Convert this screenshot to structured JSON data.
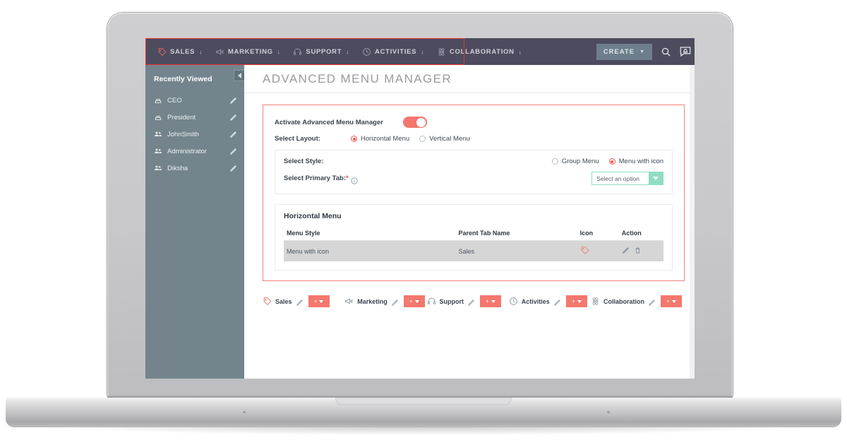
{
  "topnav": {
    "items": [
      {
        "label": "SALES",
        "icon": "tag-icon",
        "caret": "↓"
      },
      {
        "label": "MARKETING",
        "icon": "megaphone-icon",
        "caret": "↓"
      },
      {
        "label": "SUPPORT",
        "icon": "headset-icon",
        "caret": "↓"
      },
      {
        "label": "ACTIVITIES",
        "icon": "clock-icon",
        "caret": "↓"
      },
      {
        "label": "COLLABORATION",
        "icon": "atom-icon",
        "caret": "↓"
      }
    ],
    "create_label": "CREATE",
    "create_caret": "▼",
    "search_icon": "search-icon",
    "notification_icon": "notification-bell-icon",
    "highlight_color": "#ec2f2f",
    "bar_color": "#4d4c5e"
  },
  "sidebar": {
    "title": "Recently Viewed",
    "collapse_icon": "collapse-left-icon",
    "bg_color": "#73848d",
    "items": [
      {
        "label": "CEO",
        "icon": "org-icon",
        "edit_icon": "pencil-icon"
      },
      {
        "label": "President",
        "icon": "org-icon",
        "edit_icon": "pencil-icon"
      },
      {
        "label": "JohnSmith",
        "icon": "users-icon",
        "edit_icon": "pencil-icon"
      },
      {
        "label": "Administrator",
        "icon": "users-icon",
        "edit_icon": "pencil-icon"
      },
      {
        "label": "Diksha",
        "icon": "users-icon",
        "edit_icon": "pencil-icon"
      }
    ]
  },
  "page": {
    "title": "ADVANCED MENU MANAGER",
    "panel_border_color": "#f0807c"
  },
  "form": {
    "activate_label": "Activate Advanced Menu Manager",
    "activate_toggle": {
      "state": "on",
      "color": "#f4776e"
    },
    "layout_label": "Select Layout:",
    "layout_options": [
      {
        "label": "Horizontal Menu",
        "selected": true
      },
      {
        "label": "Vertical Menu",
        "selected": false
      }
    ],
    "style_label": "Select Style:",
    "style_options": [
      {
        "label": "Group Menu",
        "selected": false
      },
      {
        "label": "Menu with icon",
        "selected": true
      }
    ],
    "primary_tab_label": "Select Primary Tab:",
    "primary_tab_required": "*",
    "primary_tab_info_icon": "info-icon",
    "primary_tab_select": {
      "value": "Select an option",
      "placeholder": "Select an option",
      "border_color": "#8fddc4"
    }
  },
  "table": {
    "title": "Horizontal Menu",
    "columns": [
      "Menu Style",
      "Parent Tab Name",
      "Icon",
      "Action"
    ],
    "rows": [
      {
        "menu_style": "Menu with icon",
        "parent_tab_name": "Sales",
        "icon": "tag-icon",
        "actions": [
          "pencil-icon",
          "trash-icon"
        ]
      }
    ]
  },
  "preview": {
    "items": [
      {
        "label": "Sales",
        "icon": "tag-icon",
        "edit_icon": "pencil-icon",
        "button": {
          "plus": "+",
          "caret": "▼"
        }
      },
      {
        "label": "Marketing",
        "icon": "megaphone-icon",
        "edit_icon": "pencil-icon",
        "button": {
          "plus": "+",
          "caret": "▼"
        }
      },
      {
        "label": "Support",
        "icon": "headset-icon",
        "edit_icon": "pencil-icon",
        "button": {
          "plus": "+",
          "caret": "▼"
        }
      },
      {
        "label": "Activities",
        "icon": "clock-icon",
        "edit_icon": "pencil-icon",
        "button": {
          "plus": "+",
          "caret": "▼"
        }
      },
      {
        "label": "Collaboration",
        "icon": "atom-icon",
        "edit_icon": "pencil-icon",
        "button": {
          "plus": "+",
          "caret": "▼"
        }
      }
    ],
    "button_color": "#f4776e"
  }
}
